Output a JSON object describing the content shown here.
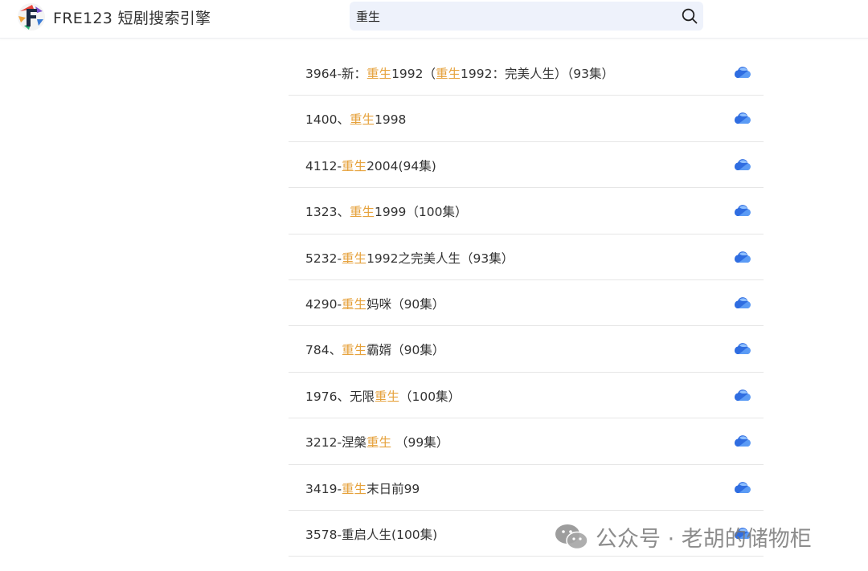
{
  "header": {
    "brand": "FRE123 短剧搜索引擎",
    "logo_icon": "app-logo-icon"
  },
  "search": {
    "value": "重生",
    "icon": "search-icon"
  },
  "results": [
    {
      "parts": [
        {
          "t": "3964-新："
        },
        {
          "t": "重生",
          "hl": true
        },
        {
          "t": "1992（"
        },
        {
          "t": "重生",
          "hl": true
        },
        {
          "t": "1992：完美人生）（93集）"
        }
      ]
    },
    {
      "parts": [
        {
          "t": "1400、"
        },
        {
          "t": "重生",
          "hl": true
        },
        {
          "t": "1998"
        }
      ]
    },
    {
      "parts": [
        {
          "t": "4112-"
        },
        {
          "t": "重生",
          "hl": true
        },
        {
          "t": "2004(94集)"
        }
      ]
    },
    {
      "parts": [
        {
          "t": "1323、"
        },
        {
          "t": "重生",
          "hl": true
        },
        {
          "t": "1999（100集）"
        }
      ]
    },
    {
      "parts": [
        {
          "t": "5232-"
        },
        {
          "t": "重生",
          "hl": true
        },
        {
          "t": "1992之完美人生（93集）"
        }
      ]
    },
    {
      "parts": [
        {
          "t": "4290-"
        },
        {
          "t": "重生",
          "hl": true
        },
        {
          "t": "妈咪（90集）"
        }
      ]
    },
    {
      "parts": [
        {
          "t": "784、"
        },
        {
          "t": "重生",
          "hl": true
        },
        {
          "t": "霸婿（90集）"
        }
      ]
    },
    {
      "parts": [
        {
          "t": "1976、无限"
        },
        {
          "t": "重生",
          "hl": true
        },
        {
          "t": "（100集）"
        }
      ]
    },
    {
      "parts": [
        {
          "t": "3212-涅槃"
        },
        {
          "t": "重生",
          "hl": true
        },
        {
          "t": " （99集）"
        }
      ]
    },
    {
      "parts": [
        {
          "t": "3419-"
        },
        {
          "t": "重生",
          "hl": true
        },
        {
          "t": "末日前99"
        }
      ]
    },
    {
      "parts": [
        {
          "t": "3578-重启人生(100集)"
        }
      ]
    }
  ],
  "row_icon": "cloud-icon",
  "watermark": {
    "text": "公众号 · 老胡的储物柜",
    "icon": "wechat-icon"
  },
  "colors": {
    "highlight": "#e6a23c",
    "cloud_blue": "#2f6de1",
    "search_bg": "#eef2fb"
  }
}
